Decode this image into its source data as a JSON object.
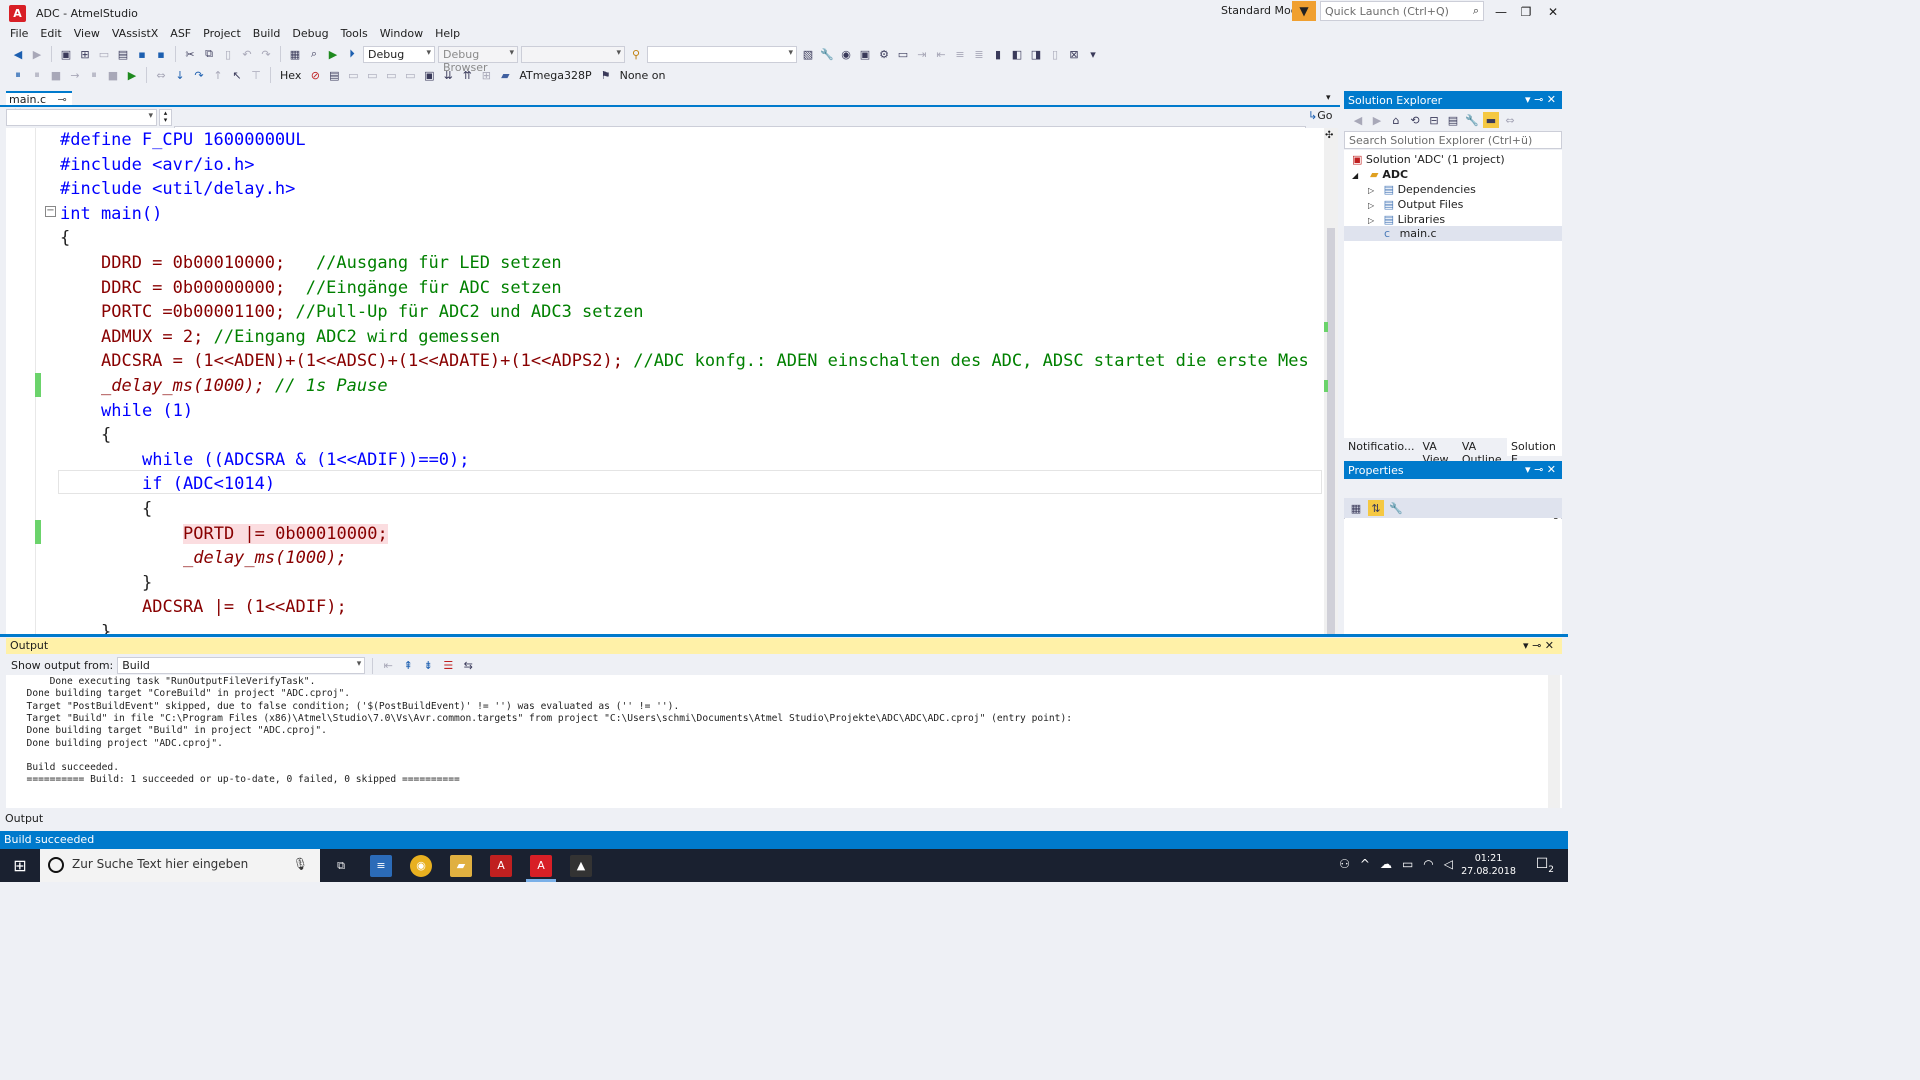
{
  "window": {
    "title": "ADC - AtmelStudio",
    "app_icon_glyph": "A",
    "mode": "Standard Mode",
    "quick_launch_placeholder": "Quick Launch (Ctrl+Q)",
    "accent_color": "#007acc"
  },
  "menu": [
    "File",
    "Edit",
    "View",
    "VAssistX",
    "ASF",
    "Project",
    "Build",
    "Debug",
    "Tools",
    "Window",
    "Help"
  ],
  "toolbar1": {
    "config": "Debug",
    "browser": "Debug Browser",
    "platform_combo": ""
  },
  "toolbar2": {
    "hex_label": "Hex",
    "device": "ATmega328P",
    "tool": "None on"
  },
  "editor": {
    "tab_label": "main.c",
    "go_label": "Go",
    "lines": [
      "#define F_CPU 16000000UL",
      "#include <avr/io.h>",
      "#include <util/delay.h>",
      "int main()",
      "{",
      "DDRD = 0b00010000;   //Ausgang für LED setzen",
      "DDRC = 0b00000000;  //Eingänge für ADC setzen",
      "PORTC =0b00001100; //Pull-Up für ADC2 und ADC3 setzen",
      "ADMUX = 2; //Eingang ADC2 wird gemessen",
      "ADCSRA = (1<<ADEN)+(1<<ADSC)+(1<<ADATE)+(1<<ADPS2); //ADC konfg.: ADEN einschalten des ADC, ADSC startet die erste Mes",
      "_delay_ms(1000); // 1s Pause",
      "while (1)",
      "{",
      "while ((ADCSRA & (1<<ADIF))==0);",
      "if (ADC<1014)",
      "{",
      "PORTD |= 0b00010000;",
      "_delay_ms(1000);",
      "}",
      "ADCSRA |= (1<<ADIF);",
      "}"
    ]
  },
  "solution_explorer": {
    "title": "Solution Explorer",
    "search_placeholder": "Search Solution Explorer (Ctrl+ü)",
    "solution": "Solution 'ADC' (1 project)",
    "project": "ADC",
    "items": [
      "Dependencies",
      "Output Files",
      "Libraries"
    ],
    "file": "main.c",
    "tabs": [
      "Notificatio...",
      "VA View",
      "VA Outline",
      "Solution E..."
    ]
  },
  "properties": {
    "title": "Properties"
  },
  "output": {
    "title": "Output",
    "show_from_label": "Show output from:",
    "source": "Build",
    "lines": [
      "      Done executing task \"RunOutputFileVerifyTask\".",
      "  Done building target \"CoreBuild\" in project \"ADC.cproj\".",
      "  Target \"PostBuildEvent\" skipped, due to false condition; ('$(PostBuildEvent)' != '') was evaluated as ('' != '').",
      "  Target \"Build\" in file \"C:\\Program Files (x86)\\Atmel\\Studio\\7.0\\Vs\\Avr.common.targets\" from project \"C:\\Users\\schmi\\Documents\\Atmel Studio\\Projekte\\ADC\\ADC\\ADC.cproj\" (entry point):",
      "  Done building target \"Build\" in project \"ADC.cproj\".",
      "  Done building project \"ADC.cproj\".",
      "",
      "  Build succeeded.",
      "  ========== Build: 1 succeeded or up-to-date, 0 failed, 0 skipped =========="
    ],
    "bottom_tab": "Output"
  },
  "status": "Build succeeded",
  "taskbar": {
    "search_placeholder": "Zur Suche Text hier eingeben",
    "time": "01:21",
    "date": "27.08.2018",
    "notification_count": "2"
  }
}
